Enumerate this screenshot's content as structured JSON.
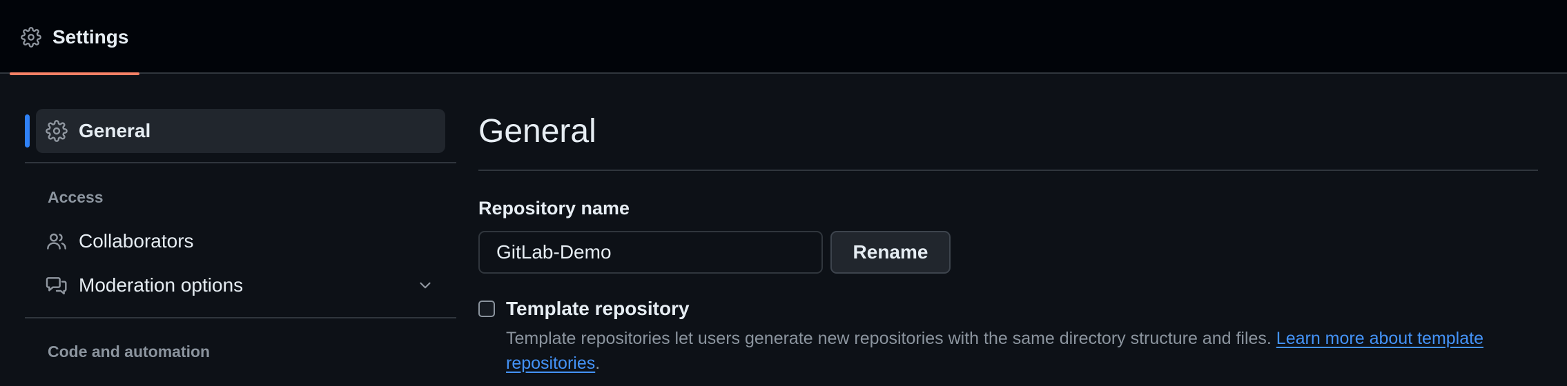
{
  "header": {
    "tab_label": "Settings",
    "tab_icon": "gear-icon",
    "accent_color": "#f78166"
  },
  "sidebar": {
    "active_item": {
      "label": "General",
      "icon": "gear-icon"
    },
    "sections": [
      {
        "heading": "Access",
        "items": [
          {
            "label": "Collaborators",
            "icon": "people-icon"
          },
          {
            "label": "Moderation options",
            "icon": "comment-discussion-icon",
            "expandable": true
          }
        ]
      },
      {
        "heading": "Code and automation",
        "items": []
      }
    ]
  },
  "main": {
    "title": "General",
    "repository_name": {
      "label": "Repository name",
      "value": "GitLab-Demo",
      "button_label": "Rename"
    },
    "template_repository": {
      "label": "Template repository",
      "checked": false,
      "description": "Template repositories let users generate new repositories with the same directory structure and files. ",
      "link_text": "Learn more about template repositories",
      "trailing": "."
    }
  },
  "colors": {
    "background": "#0d1117",
    "topbar": "#010409",
    "link": "#4493f8",
    "active_marker": "#2f81f7"
  }
}
